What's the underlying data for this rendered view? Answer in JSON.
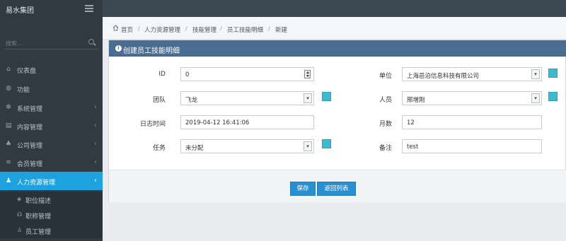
{
  "app": {
    "brand": "易水集团"
  },
  "search": {
    "placeholder": "搜索..."
  },
  "sidebar": {
    "items": [
      {
        "label": "仪表盘",
        "icon": "home-icon"
      },
      {
        "label": "功能",
        "icon": "globe-icon"
      },
      {
        "label": "系统管理",
        "icon": "gears-icon"
      },
      {
        "label": "内容管理",
        "icon": "list-icon"
      },
      {
        "label": "公司管理",
        "icon": "org-chart-icon"
      },
      {
        "label": "会员管理",
        "icon": "wifi-icon"
      },
      {
        "label": "人力资源管理",
        "icon": "users-icon"
      }
    ],
    "subitems": [
      {
        "label": "职位描述",
        "icon": "badge-icon"
      },
      {
        "label": "职称管理",
        "icon": "headset-icon"
      },
      {
        "label": "员工管理",
        "icon": "user-icon"
      }
    ]
  },
  "breadcrumb": [
    "首页",
    "人力资源管理",
    "技能管理",
    "员工技能明细",
    "新建"
  ],
  "panel": {
    "title": "创建员工技能明细"
  },
  "form": {
    "id": {
      "label": "ID",
      "value": "0"
    },
    "unit": {
      "label": "单位",
      "value": "上海邑泊信息科技有限公司"
    },
    "team": {
      "label": "团队",
      "value": "飞龙"
    },
    "person": {
      "label": "人员",
      "value": "邢增刚"
    },
    "log_time": {
      "label": "日志时间",
      "value": "2019-04-12 16:41:06"
    },
    "months": {
      "label": "月数",
      "value": "12"
    },
    "task": {
      "label": "任务",
      "value": "未分配"
    },
    "note": {
      "label": "备注",
      "value": "test"
    }
  },
  "buttons": {
    "save": "保存",
    "back": "返回列表"
  },
  "colors": {
    "accent": "#1ea1df",
    "panel_header": "#4a6d92",
    "add_button": "#3fb9cf",
    "primary_button": "#2a8fd0"
  }
}
